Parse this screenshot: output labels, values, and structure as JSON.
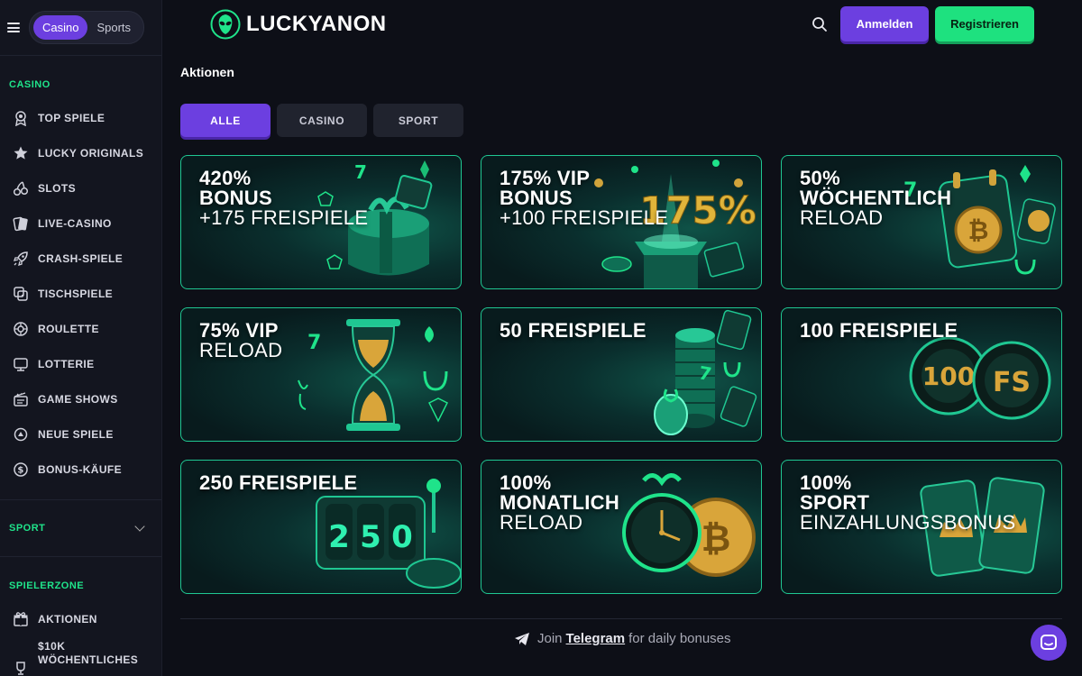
{
  "header": {
    "brand": "LUCKYANON",
    "login_label": "Anmelden",
    "register_label": "Registrieren"
  },
  "sidebar": {
    "mode_tabs": [
      "Casino",
      "Sports"
    ],
    "casino_title": "CASINO",
    "casino_items": [
      {
        "label": "TOP SPIELE",
        "icon": "medal-icon"
      },
      {
        "label": "LUCKY ORIGINALS",
        "icon": "star-icon"
      },
      {
        "label": "SLOTS",
        "icon": "cherry-icon"
      },
      {
        "label": "LIVE-CASINO",
        "icon": "live-cards-icon"
      },
      {
        "label": "CRASH-SPIELE",
        "icon": "rocket-icon"
      },
      {
        "label": "TISCHSPIELE",
        "icon": "table-games-icon"
      },
      {
        "label": "ROULETTE",
        "icon": "roulette-icon"
      },
      {
        "label": "LOTTERIE",
        "icon": "lottery-icon"
      },
      {
        "label": "GAME SHOWS",
        "icon": "game-show-icon"
      },
      {
        "label": "NEUE SPIELE",
        "icon": "new-games-icon"
      },
      {
        "label": "BONUS-KÄUFE",
        "icon": "bonus-buy-icon"
      }
    ],
    "sport_title": "SPORT",
    "player_zone_title": "SPIELERZONE",
    "player_items": [
      {
        "label": "AKTIONEN",
        "icon": "gift-icon"
      },
      {
        "label": "$10K WÖCHENTLICHES",
        "icon": "trophy-icon"
      }
    ]
  },
  "main": {
    "title": "Aktionen",
    "filter_tabs": [
      "ALLE",
      "CASINO",
      "SPORT"
    ],
    "promos": [
      {
        "l1": "420%",
        "l1b": "BONUS",
        "l2": "+175 FREISPIELE",
        "art": "gift-box"
      },
      {
        "l1": "175% VIP",
        "l1b": "BONUS",
        "l2": "+100 FREISPIELE",
        "art": "175-box",
        "art_text": "175%"
      },
      {
        "l1": "50%",
        "l1b": "WÖCHENTLICH",
        "l2": "RELOAD",
        "art": "bitcoin-calendar"
      },
      {
        "l1": "75% VIP",
        "l1b": "",
        "l2": "RELOAD",
        "art": "hourglass"
      },
      {
        "l1": "50 FREISPIELE",
        "l1b": "",
        "l2": "",
        "art": "chip-stack"
      },
      {
        "l1": "100 FREISPIELE",
        "l1b": "",
        "l2": "",
        "art": "chips-100-fs",
        "art_text": "100",
        "art_text2": "FS"
      },
      {
        "l1": "250 FREISPIELE",
        "l1b": "",
        "l2": "",
        "art": "slot-250",
        "art_text": "250"
      },
      {
        "l1": "100%",
        "l1b": "MONATLICH",
        "l2": "RELOAD",
        "art": "clock-bitcoin"
      },
      {
        "l1": "100%",
        "l1b": "SPORT",
        "l2": "EINZAHLUNGSBONUS",
        "art": "crown-cards"
      }
    ]
  },
  "footer": {
    "telegram_prefix": "Join",
    "telegram_link": "Telegram",
    "telegram_suffix": "for daily bonuses"
  },
  "colors": {
    "accent_purple": "#6c3fe0",
    "accent_green": "#1ee17f",
    "card_border": "#1fc792",
    "background": "#0d0f17"
  }
}
